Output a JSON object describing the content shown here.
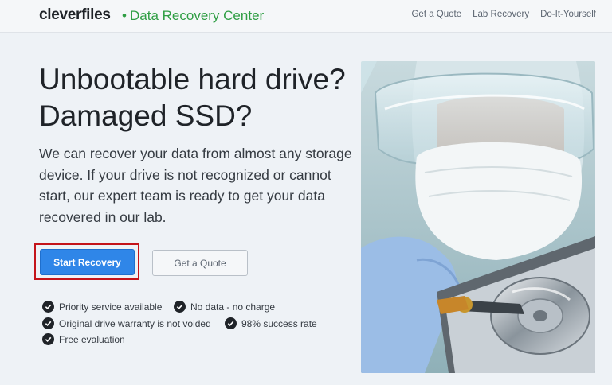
{
  "header": {
    "logo": "cleverfiles",
    "logo_dot": "•",
    "logo_sub": "Data Recovery Center",
    "nav": [
      "Get a Quote",
      "Lab Recovery",
      "Do-It-Yourself"
    ]
  },
  "hero": {
    "headline": "Unbootable hard drive? Damaged SSD?",
    "lead": "We can recover your data from almost any storage device. If your drive is not recognized or cannot start, our expert team is ready to get your data recovered in our lab.",
    "primary_button": "Start Recovery",
    "secondary_button": "Get a Quote"
  },
  "features": [
    "Priority service available",
    "No data - no charge",
    "Original drive warranty is not voided",
    "98% success rate",
    "Free evaluation"
  ],
  "colors": {
    "accent": "#2f86e8",
    "brand_green": "#2f9e44",
    "highlight": "#c4141a"
  }
}
